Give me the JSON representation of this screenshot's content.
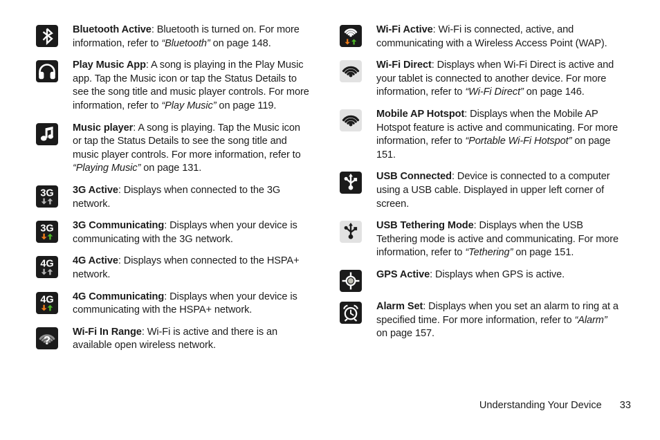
{
  "footer": {
    "section_title": "Understanding Your Device",
    "page_number": "33"
  },
  "colors": {
    "tile_dark": "#1b1b1b",
    "tile_light": "#e2e2e2",
    "glyph_light": "#ffffff",
    "glyph_gray": "#b4b4b4",
    "arrow_down_orange": "#f07d1a",
    "arrow_up_green": "#4cb827",
    "text": "#1c1c1c"
  },
  "left_column": [
    {
      "icon": "bluetooth-icon",
      "term": "Bluetooth Active",
      "body_1": ": Bluetooth is turned on. For more information, refer to ",
      "ref": "“Bluetooth”",
      "body_2": " on page 148."
    },
    {
      "icon": "headphones-play-music-icon",
      "term": "Play Music App",
      "body_1": ": A song is playing in the Play Music app. Tap the Music icon or tap the Status Details to see the song title and music player controls. For more information, refer to ",
      "ref": "“Play Music”",
      "body_2": " on page 119."
    },
    {
      "icon": "music-note-icon",
      "term": "Music player",
      "body_1": ": A song is playing. Tap the Music icon or tap the Status Details to see the song title and music player controls. For more information, refer to ",
      "ref": "“Playing Music”",
      "body_2": " on page 131."
    },
    {
      "icon": "3g-active-icon",
      "term": "3G Active",
      "body_1": ": Displays when connected to the 3G network.",
      "ref": "",
      "body_2": ""
    },
    {
      "icon": "3g-communicating-icon",
      "term": "3G Communicating",
      "body_1": ": Displays when your device is communicating with the 3G network.",
      "ref": "",
      "body_2": ""
    },
    {
      "icon": "4g-active-icon",
      "term": "4G Active",
      "body_1": ": Displays when connected to the HSPA+ network.",
      "ref": "",
      "body_2": ""
    },
    {
      "icon": "4g-communicating-icon",
      "term": "4G Communicating",
      "body_1": ": Displays when your device is communicating with the HSPA+ network.",
      "ref": "",
      "body_2": ""
    },
    {
      "icon": "wifi-in-range-icon",
      "term": "Wi-Fi In Range",
      "body_1": ": Wi-Fi is active and there is an available open wireless network.",
      "ref": "",
      "body_2": ""
    }
  ],
  "right_column": [
    {
      "icon": "wifi-active-icon",
      "term": "Wi-Fi Active",
      "body_1": ": Wi-Fi is connected, active, and communicating with a Wireless Access Point (WAP).",
      "ref": "",
      "body_2": ""
    },
    {
      "icon": "wifi-direct-icon",
      "term": "Wi-Fi Direct",
      "body_1": ": Displays when Wi-Fi Direct is active and your tablet is connected to another device. For more information, refer to ",
      "ref": "“Wi-Fi Direct”",
      "body_2": " on page 146."
    },
    {
      "icon": "mobile-ap-hotspot-icon",
      "term": "Mobile AP Hotspot",
      "body_1": ": Displays when the Mobile AP Hotspot feature is active and communicating. For more information, refer to ",
      "ref": "“Portable Wi-Fi Hotspot”",
      "body_2": " on page 151."
    },
    {
      "icon": "usb-connected-icon",
      "term": "USB Connected",
      "body_1": ": Device is connected to a computer using a USB cable. Displayed in upper left corner of screen.",
      "ref": "",
      "body_2": ""
    },
    {
      "icon": "usb-tethering-icon",
      "term": "USB Tethering Mode",
      "body_1": ": Displays when the USB Tethering mode is active and communicating. For more information, refer to ",
      "ref": "“Tethering”",
      "body_2": " on page 151."
    },
    {
      "icon": "gps-active-icon",
      "term": "GPS Active",
      "body_1": ": Displays when GPS is active.",
      "ref": "",
      "body_2": ""
    },
    {
      "icon": "alarm-set-icon",
      "term": "Alarm Set",
      "body_1": ": Displays when you set an alarm to ring at a specified time. For more information, refer to ",
      "ref": "“Alarm”",
      "body_2": " on page 157."
    }
  ]
}
